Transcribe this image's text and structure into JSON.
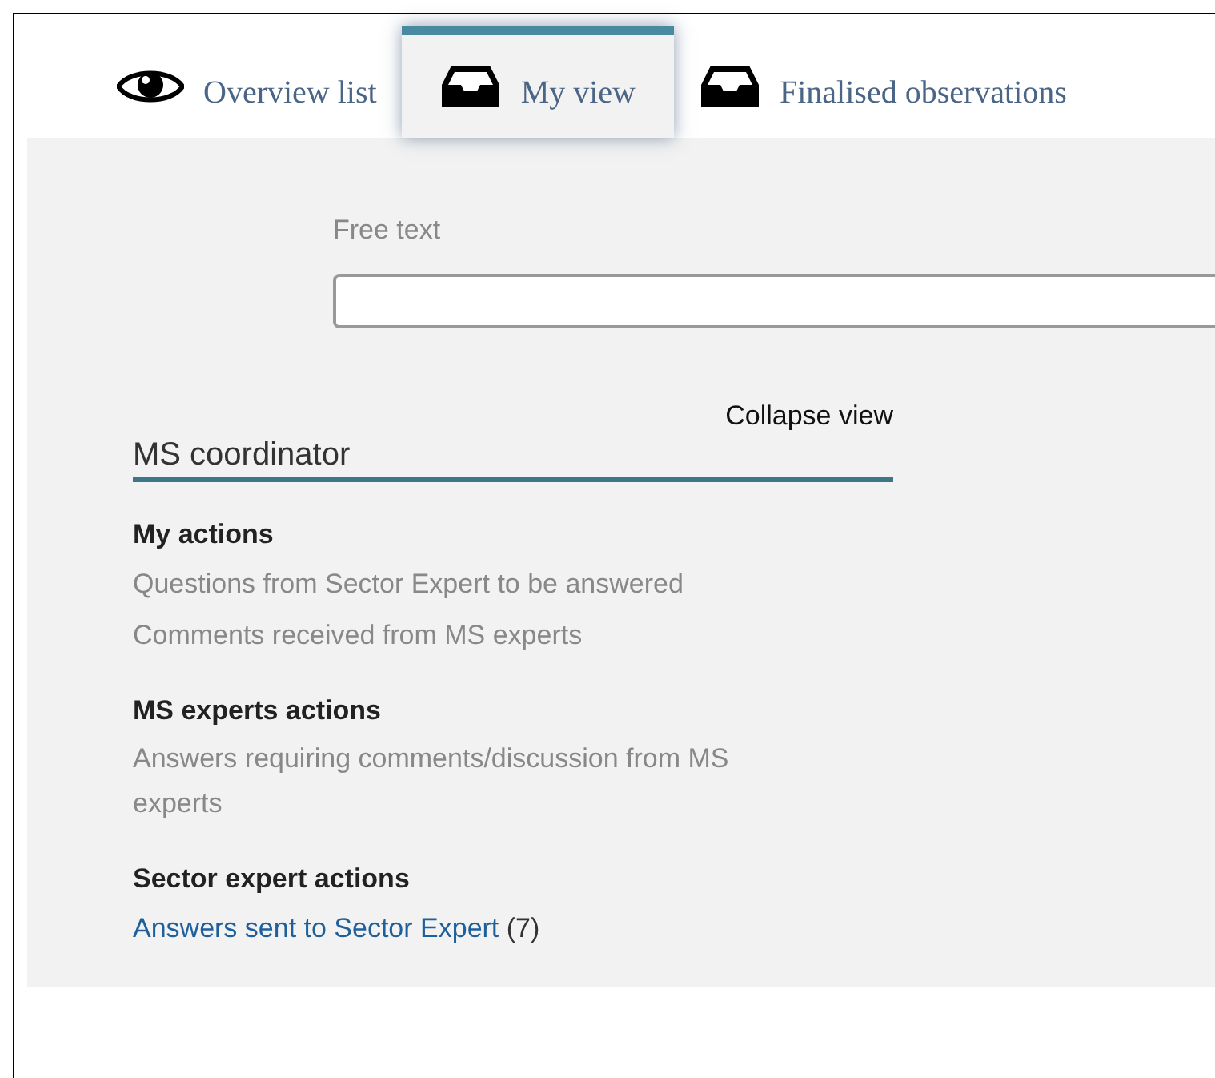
{
  "tabs": [
    {
      "label": "Overview list",
      "kind": "eye",
      "selected": false
    },
    {
      "label": "My view",
      "kind": "inbox",
      "selected": true
    },
    {
      "label": "Finalised observations",
      "kind": "inbox",
      "selected": false
    }
  ],
  "search": {
    "label": "Free text"
  },
  "collapse_link": "Collapse view",
  "role_heading": "MS coordinator",
  "sections": [
    {
      "title": "My actions",
      "items": [
        {
          "label": "Questions from Sector Expert to be answered",
          "disabled": true
        },
        {
          "label": "Comments received from MS experts",
          "disabled": true
        }
      ]
    },
    {
      "title": "MS experts actions",
      "items": [
        {
          "label": "Answers requiring comments/discussion from MS experts",
          "disabled": true
        }
      ]
    },
    {
      "title": "Sector expert actions",
      "items": [
        {
          "label": "Answers sent to Sector Expert",
          "disabled": false,
          "count": "(7)"
        }
      ]
    }
  ]
}
